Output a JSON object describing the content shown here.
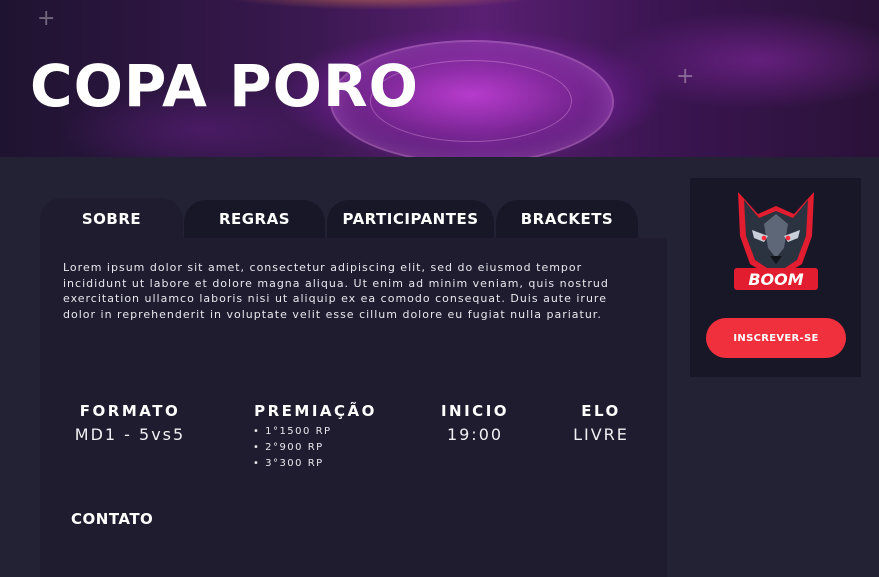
{
  "hero": {
    "title": "COPA PORO"
  },
  "tabs": [
    {
      "label": "SOBRE",
      "active": true
    },
    {
      "label": "REGRAS",
      "active": false
    },
    {
      "label": "PARTICIPANTES",
      "active": false
    },
    {
      "label": "BRACKETS",
      "active": false
    }
  ],
  "about": {
    "text": "Lorem ipsum dolor sit amet, consectetur adipiscing elit, sed do eiusmod tempor incididunt ut labore et dolore magna aliqua. Ut enim ad minim veniam, quis nostrud exercitation ullamco laboris nisi ut aliquip ex ea comodo consequat. Duis aute irure dolor in reprehenderit in voluptate velit esse cillum dolore eu fugiat nulla pariatur."
  },
  "stats": {
    "formato": {
      "label": "FORMATO",
      "value": "MD1 - 5vs5"
    },
    "premiacao": {
      "label": "PREMIAÇÃO",
      "prizes": [
        "1°1500 RP",
        "2°900 RP",
        "3°300 RP"
      ]
    },
    "inicio": {
      "label": "INICIO",
      "value": "19:00"
    },
    "elo": {
      "label": "ELO",
      "value": "LIVRE"
    }
  },
  "contato": {
    "title": "CONTATO"
  },
  "team": {
    "logo_text": "BOOM",
    "icon": "wolf-logo-icon"
  },
  "subscribe": {
    "label": "INSCREVER-SE"
  },
  "colors": {
    "background": "#232235",
    "panel": "#1e1c2e",
    "card": "#181727",
    "accent": "#f0313d",
    "hero_purple": "#5a1f72"
  }
}
